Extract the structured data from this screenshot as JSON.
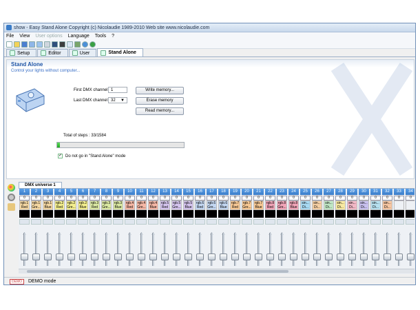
{
  "window": {
    "title": "show - Easy Stand Alone   Copyright (c) Nicolaudie 1989-2010   Web site www.nicolaudie.com"
  },
  "menu": [
    "File",
    "View",
    "User options",
    "Language",
    "Tools",
    "?"
  ],
  "tabs": [
    "Setup",
    "Editor",
    "User",
    "Stand Alone"
  ],
  "standalone": {
    "title": "Stand Alone",
    "subtitle": "Control your lights without computer...",
    "first_dmx_label": "First DMX channel",
    "first_dmx_value": "1",
    "last_dmx_label": "Last DMX channel",
    "last_dmx_value": "32",
    "total_steps": "Total of steps : 33/1584",
    "progress": 0.021,
    "write_button": "Write memory...",
    "erase_button": "Erase memory",
    "read_button": "Read memory...",
    "checkbox_label": "Do not go in \"Stand Alone\" mode",
    "checkbox_checked": true
  },
  "universe_tab": "DMX universe 1",
  "channels": [
    {
      "n": "1",
      "v": "0",
      "l1": "rgb.1",
      "l2": "Red",
      "c": "#f4d7a2"
    },
    {
      "n": "2",
      "v": "0",
      "l1": "rgb.1",
      "l2": "Gre...",
      "c": "#f4d7a2"
    },
    {
      "n": "3",
      "v": "0",
      "l1": "rgb.1",
      "l2": "Blue",
      "c": "#f4d7a2"
    },
    {
      "n": "4",
      "v": "0",
      "l1": "rgb.2",
      "l2": "Red",
      "c": "#f4ef8f"
    },
    {
      "n": "5",
      "v": "0",
      "l1": "rgb.2",
      "l2": "Gre...",
      "c": "#f4ef8f"
    },
    {
      "n": "6",
      "v": "0",
      "l1": "rgb.2",
      "l2": "Blue",
      "c": "#f4ef8f"
    },
    {
      "n": "7",
      "v": "0",
      "l1": "rgb.3",
      "l2": "Red",
      "c": "#dbe9a3"
    },
    {
      "n": "8",
      "v": "0",
      "l1": "rgb.3",
      "l2": "Gre...",
      "c": "#dbe9a3"
    },
    {
      "n": "9",
      "v": "0",
      "l1": "rgb.3",
      "l2": "Blue",
      "c": "#dbe9a3"
    },
    {
      "n": "10",
      "v": "0",
      "l1": "rgb.4",
      "l2": "Red",
      "c": "#f5b7a5"
    },
    {
      "n": "11",
      "v": "0",
      "l1": "rgb.4",
      "l2": "Gre...",
      "c": "#f5b7a5"
    },
    {
      "n": "12",
      "v": "0",
      "l1": "rgb.4",
      "l2": "Blue",
      "c": "#f5b7a5"
    },
    {
      "n": "13",
      "v": "0",
      "l1": "rgb.5",
      "l2": "Red",
      "c": "#d5c5ef"
    },
    {
      "n": "14",
      "v": "0",
      "l1": "rgb.5",
      "l2": "Gre...",
      "c": "#d5c5ef"
    },
    {
      "n": "15",
      "v": "0",
      "l1": "rgb.5",
      "l2": "Blue",
      "c": "#d5c5ef"
    },
    {
      "n": "16",
      "v": "0",
      "l1": "rgb.6",
      "l2": "Red",
      "c": "#c3d7f2"
    },
    {
      "n": "17",
      "v": "0",
      "l1": "rgb.6",
      "l2": "Gre...",
      "c": "#c3d7f2"
    },
    {
      "n": "18",
      "v": "0",
      "l1": "rgb.6",
      "l2": "Blue",
      "c": "#c3d7f2"
    },
    {
      "n": "19",
      "v": "0",
      "l1": "rgb.7",
      "l2": "Red",
      "c": "#f7c894"
    },
    {
      "n": "20",
      "v": "0",
      "l1": "rgb.7",
      "l2": "Gre...",
      "c": "#f7c894"
    },
    {
      "n": "21",
      "v": "0",
      "l1": "rgb.7",
      "l2": "Blue",
      "c": "#f7c894"
    },
    {
      "n": "22",
      "v": "0",
      "l1": "rgb.8",
      "l2": "Red",
      "c": "#f1a5b8"
    },
    {
      "n": "23",
      "v": "0",
      "l1": "rgb.8",
      "l2": "Gre...",
      "c": "#f1a5b8"
    },
    {
      "n": "24",
      "v": "0",
      "l1": "rgb.8",
      "l2": "Blue",
      "c": "#f1a5b8"
    },
    {
      "n": "25",
      "v": "0",
      "l1": "sin...",
      "l2": "Di...",
      "c": "#a7d9f2"
    },
    {
      "n": "26",
      "v": "0",
      "l1": "sin...",
      "l2": "Di...",
      "c": "#f5cfa3"
    },
    {
      "n": "27",
      "v": "0",
      "l1": "sin...",
      "l2": "Di...",
      "c": "#bfe6c4"
    },
    {
      "n": "28",
      "v": "0",
      "l1": "sin...",
      "l2": "Di...",
      "c": "#f8e9a1"
    },
    {
      "n": "29",
      "v": "0",
      "l1": "sin...",
      "l2": "Di...",
      "c": "#f2b8c6"
    },
    {
      "n": "30",
      "v": "0",
      "l1": "sin...",
      "l2": "Di...",
      "c": "#c8c0ee"
    },
    {
      "n": "31",
      "v": "0",
      "l1": "sin...",
      "l2": "Di...",
      "c": "#b6e0ef"
    },
    {
      "n": "32",
      "v": "0",
      "l1": "sin...",
      "l2": "Di...",
      "c": "#f6c6a2"
    },
    {
      "n": "33",
      "v": "0",
      "l1": "",
      "l2": "",
      "c": "#eef1f5"
    },
    {
      "n": "34",
      "v": "0",
      "l1": "",
      "l2": "",
      "c": "#eef1f5"
    }
  ],
  "status": {
    "badge": "DEMO",
    "text": "DEMO mode"
  }
}
